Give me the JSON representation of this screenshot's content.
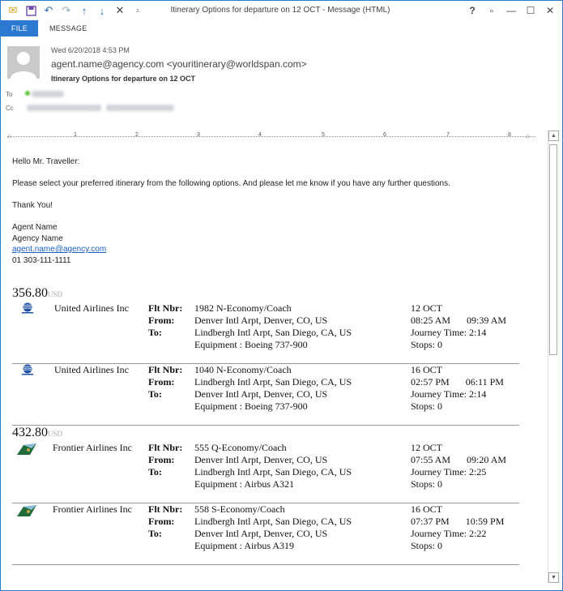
{
  "window": {
    "title": "Itinerary Options for departure on 12 OCT - Message (HTML)",
    "controls": [
      "?",
      "▫",
      "—",
      "☐",
      "✕"
    ]
  },
  "ribbon": {
    "file": "FILE",
    "message": "MESSAGE"
  },
  "header": {
    "datetime": "Wed 6/20/2018 4:53 PM",
    "sender": "agent.name@agency.com <youritinerary@worldspan.com>",
    "subject": "Itinerary Options for departure on 12 OCT",
    "to_label": "To",
    "cc_label": "Cc"
  },
  "ruler": [
    "1",
    "2",
    "3",
    "4",
    "5",
    "6",
    "7",
    "8"
  ],
  "body": {
    "greeting": "Hello Mr. Traveller:",
    "intro": "Please select your preferred itinerary from the following options. And please let me know if you have any further questions.",
    "thanks": "Thank You!",
    "signature": {
      "name": "Agent Name",
      "agency": "Agency Name",
      "email": "agent.name@agency.com",
      "phone": "01 303-111-1111"
    }
  },
  "options": [
    {
      "price": "356.80",
      "currency": "USD",
      "flights": [
        {
          "airline": "United Airlines Inc",
          "flt_label": "Flt Nbr:",
          "from_label": "From:",
          "to_label": "To:",
          "flt": "1982 N-Economy/Coach",
          "from": "Denver Intl Arpt, Denver, CO, US",
          "to": "Lindbergh Intl Arpt, San Diego, CA, US",
          "equipment": "Equipment : Boeing 737-900",
          "date": "12 OCT",
          "depart": "08:25 AM",
          "arrive": "09:39 AM",
          "journey": "Journey Time: 2:14",
          "stops": "Stops: 0"
        },
        {
          "airline": "United Airlines Inc",
          "flt_label": "Flt Nbr:",
          "from_label": "From:",
          "to_label": "To:",
          "flt": "1040 N-Economy/Coach",
          "from": "Lindbergh Intl Arpt, San Diego, CA, US",
          "to": "Denver Intl Arpt, Denver, CO, US",
          "equipment": "Equipment : Boeing 737-900",
          "date": "16 OCT",
          "depart": "02:57 PM",
          "arrive": "06:11 PM",
          "journey": "Journey Time: 2:14",
          "stops": "Stops: 0"
        }
      ]
    },
    {
      "price": "432.80",
      "currency": "USD",
      "flights": [
        {
          "airline": "Frontier Airlines Inc",
          "flt_label": "Flt Nbr:",
          "from_label": "From:",
          "to_label": "To:",
          "flt": "555 Q-Economy/Coach",
          "from": "Denver Intl Arpt, Denver, CO, US",
          "to": "Lindbergh Intl Arpt, San Diego, CA, US",
          "equipment": "Equipment : Airbus A321",
          "date": "12 OCT",
          "depart": "07:55 AM",
          "arrive": "09:20 AM",
          "journey": "Journey Time: 2:25",
          "stops": "Stops: 0"
        },
        {
          "airline": "Frontier Airlines Inc",
          "flt_label": "Flt Nbr:",
          "from_label": "From:",
          "to_label": "To:",
          "flt": "558 S-Economy/Coach",
          "from": "Lindbergh Intl Arpt, San Diego, CA, US",
          "to": "Denver Intl Arpt, Denver, CO, US",
          "equipment": "Equipment : Airbus A319",
          "date": "16 OCT",
          "depart": "07:37 PM",
          "arrive": "10:59 PM",
          "journey": "Journey Time: 2:22",
          "stops": "Stops: 0"
        }
      ]
    }
  ]
}
